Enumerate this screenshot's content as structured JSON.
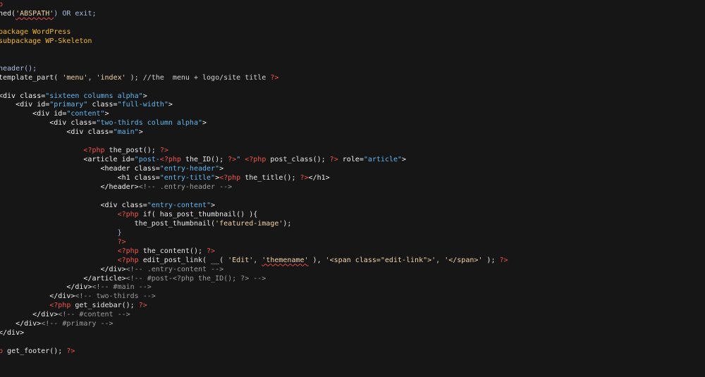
{
  "editor": {
    "lines": [
      [
        {
          "t": "p",
          "c": "c-php"
        }
      ],
      [
        {
          "t": "ned(",
          "c": "c-fn"
        },
        {
          "t": "'ABSPATH'",
          "c": "c-pstr",
          "s": true
        },
        {
          "t": ") OR exit;",
          "c": "c-kw"
        }
      ],
      [],
      [
        {
          "t": "package WordPress",
          "c": "c-doc"
        }
      ],
      [
        {
          "t": "subpackage WP-Skeleton",
          "c": "c-doc"
        }
      ],
      [],
      [],
      [
        {
          "t": "header();",
          "c": "c-kw"
        }
      ],
      [
        {
          "t": "template_part( ",
          "c": "c-fn"
        },
        {
          "t": "'menu'",
          "c": "c-pstr"
        },
        {
          "t": ", ",
          "c": "c-text"
        },
        {
          "t": "'index'",
          "c": "c-pstr"
        },
        {
          "t": " ); //the  menu + logo/site title ",
          "c": "c-text"
        },
        {
          "t": "?>",
          "c": "c-php"
        }
      ],
      [],
      [
        {
          "t": "<div ",
          "c": "c-tag"
        },
        {
          "t": "class=",
          "c": "c-attr"
        },
        {
          "t": "\"sixteen columns alpha\"",
          "c": "c-str"
        },
        {
          "t": ">",
          "c": "c-tag"
        }
      ],
      [
        {
          "t": "    <div ",
          "c": "c-tag"
        },
        {
          "t": "id=",
          "c": "c-attr"
        },
        {
          "t": "\"primary\"",
          "c": "c-str"
        },
        {
          "t": " class=",
          "c": "c-attr"
        },
        {
          "t": "\"full-width\"",
          "c": "c-str"
        },
        {
          "t": ">",
          "c": "c-tag"
        }
      ],
      [
        {
          "t": "        <div ",
          "c": "c-tag"
        },
        {
          "t": "id=",
          "c": "c-attr"
        },
        {
          "t": "\"content\"",
          "c": "c-str"
        },
        {
          "t": ">",
          "c": "c-tag"
        }
      ],
      [
        {
          "t": "            <div ",
          "c": "c-tag"
        },
        {
          "t": "class=",
          "c": "c-attr"
        },
        {
          "t": "\"two-thirds column alpha\"",
          "c": "c-str"
        },
        {
          "t": ">",
          "c": "c-tag"
        }
      ],
      [
        {
          "t": "                <div ",
          "c": "c-tag"
        },
        {
          "t": "class=",
          "c": "c-attr"
        },
        {
          "t": "\"main\"",
          "c": "c-str"
        },
        {
          "t": ">",
          "c": "c-tag"
        }
      ],
      [],
      [
        {
          "t": "                    ",
          "c": "c-text"
        },
        {
          "t": "<?php",
          "c": "c-php"
        },
        {
          "t": " the_post(); ",
          "c": "c-fn"
        },
        {
          "t": "?>",
          "c": "c-php"
        }
      ],
      [
        {
          "t": "                    <article ",
          "c": "c-tag"
        },
        {
          "t": "id=",
          "c": "c-attr"
        },
        {
          "t": "\"post-",
          "c": "c-str"
        },
        {
          "t": "<?php",
          "c": "c-php"
        },
        {
          "t": " the_ID(); ",
          "c": "c-fn"
        },
        {
          "t": "?>",
          "c": "c-php"
        },
        {
          "t": "\"",
          "c": "c-str"
        },
        {
          "t": " ",
          "c": "c-text"
        },
        {
          "t": "<?php",
          "c": "c-php"
        },
        {
          "t": " post_class(); ",
          "c": "c-fn"
        },
        {
          "t": "?>",
          "c": "c-php"
        },
        {
          "t": " role=",
          "c": "c-attr"
        },
        {
          "t": "\"article\"",
          "c": "c-str"
        },
        {
          "t": ">",
          "c": "c-tag"
        }
      ],
      [
        {
          "t": "                        <header ",
          "c": "c-tag"
        },
        {
          "t": "class=",
          "c": "c-attr"
        },
        {
          "t": "\"entry-header\"",
          "c": "c-str"
        },
        {
          "t": ">",
          "c": "c-tag"
        }
      ],
      [
        {
          "t": "                            <h1 ",
          "c": "c-tag"
        },
        {
          "t": "class=",
          "c": "c-attr"
        },
        {
          "t": "\"entry-title\"",
          "c": "c-str"
        },
        {
          "t": ">",
          "c": "c-tag"
        },
        {
          "t": "<?php",
          "c": "c-php"
        },
        {
          "t": " the_title(); ",
          "c": "c-fn"
        },
        {
          "t": "?>",
          "c": "c-php"
        },
        {
          "t": "</h1>",
          "c": "c-tag"
        }
      ],
      [
        {
          "t": "                        </header>",
          "c": "c-tag"
        },
        {
          "t": "<!-- .entry-header -->",
          "c": "c-comm"
        }
      ],
      [],
      [
        {
          "t": "                        <div ",
          "c": "c-tag"
        },
        {
          "t": "class=",
          "c": "c-attr"
        },
        {
          "t": "\"entry-content\"",
          "c": "c-str"
        },
        {
          "t": ">",
          "c": "c-tag"
        }
      ],
      [
        {
          "t": "                            ",
          "c": "c-text"
        },
        {
          "t": "<?php",
          "c": "c-php"
        },
        {
          "t": " if( has_post_thumbnail() ){",
          "c": "c-fn"
        }
      ],
      [
        {
          "t": "                                the_post_thumbnail(",
          "c": "c-fn"
        },
        {
          "t": "'featured-image'",
          "c": "c-pstr"
        },
        {
          "t": ");",
          "c": "c-fn"
        }
      ],
      [
        {
          "t": "                            }",
          "c": "c-kw"
        }
      ],
      [
        {
          "t": "                            ",
          "c": "c-text"
        },
        {
          "t": "?>",
          "c": "c-php"
        }
      ],
      [
        {
          "t": "                            ",
          "c": "c-text"
        },
        {
          "t": "<?php",
          "c": "c-php"
        },
        {
          "t": " the_content(); ",
          "c": "c-fn"
        },
        {
          "t": "?>",
          "c": "c-php"
        }
      ],
      [
        {
          "t": "                            ",
          "c": "c-text"
        },
        {
          "t": "<?php",
          "c": "c-php"
        },
        {
          "t": " edit_post_link( __( ",
          "c": "c-fn"
        },
        {
          "t": "'Edit'",
          "c": "c-pstr"
        },
        {
          "t": ", ",
          "c": "c-text"
        },
        {
          "t": "'themename'",
          "c": "c-pstr",
          "s": true
        },
        {
          "t": " ), ",
          "c": "c-fn"
        },
        {
          "t": "'<span class=\"edit-link\">'",
          "c": "c-pstr"
        },
        {
          "t": ", ",
          "c": "c-text"
        },
        {
          "t": "'</span>'",
          "c": "c-pstr"
        },
        {
          "t": " ); ",
          "c": "c-fn"
        },
        {
          "t": "?>",
          "c": "c-php"
        }
      ],
      [
        {
          "t": "                        </div>",
          "c": "c-tag"
        },
        {
          "t": "<!-- .entry-content -->",
          "c": "c-comm"
        }
      ],
      [
        {
          "t": "                    </article>",
          "c": "c-tag"
        },
        {
          "t": "<!-- #post-<?php the_ID(); ?> -->",
          "c": "c-comm"
        }
      ],
      [
        {
          "t": "                </div>",
          "c": "c-tag"
        },
        {
          "t": "<!-- #main -->",
          "c": "c-comm"
        }
      ],
      [
        {
          "t": "            </div>",
          "c": "c-tag"
        },
        {
          "t": "<!-- two-thirds -->",
          "c": "c-comm"
        }
      ],
      [
        {
          "t": "            ",
          "c": "c-text"
        },
        {
          "t": "<?php",
          "c": "c-php"
        },
        {
          "t": " get_sidebar(); ",
          "c": "c-fn"
        },
        {
          "t": "?>",
          "c": "c-php"
        }
      ],
      [
        {
          "t": "        </div>",
          "c": "c-tag"
        },
        {
          "t": "<!-- #content -->",
          "c": "c-comm"
        }
      ],
      [
        {
          "t": "    </div>",
          "c": "c-tag"
        },
        {
          "t": "<!-- #primary -->",
          "c": "c-comm"
        }
      ],
      [
        {
          "t": "</div>",
          "c": "c-tag"
        }
      ],
      [],
      [
        {
          "t": "p",
          "c": "c-php"
        },
        {
          "t": " get_footer(); ",
          "c": "c-fn"
        },
        {
          "t": "?>",
          "c": "c-php"
        }
      ]
    ]
  }
}
